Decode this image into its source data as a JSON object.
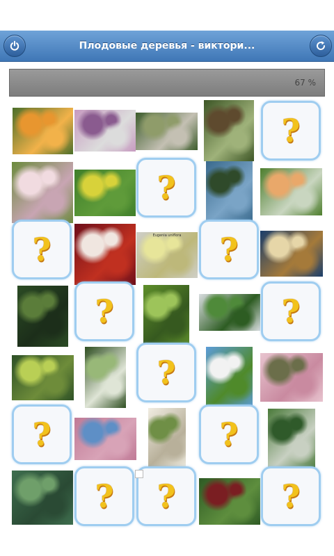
{
  "header": {
    "title": "Плодовые деревья - виктори...",
    "left_button_icon": "power-icon",
    "right_button_icon": "refresh-icon"
  },
  "progress": {
    "value_percent": 67,
    "label": "67 %"
  },
  "card_back": {
    "symbol": "?",
    "color": "#f2c21c"
  },
  "board": {
    "columns": 5,
    "rows": 7,
    "tiles": [
      {
        "state": "revealed",
        "subject": "apricots"
      },
      {
        "state": "revealed",
        "subject": "flowering-tree"
      },
      {
        "state": "revealed",
        "subject": "palm-fronds"
      },
      {
        "state": "revealed",
        "subject": "dark-fruits"
      },
      {
        "state": "hidden"
      },
      {
        "state": "revealed",
        "subject": "quince-blossom"
      },
      {
        "state": "revealed",
        "subject": "yellow-fruit-leaves"
      },
      {
        "state": "hidden"
      },
      {
        "state": "revealed",
        "subject": "tree-canopy"
      },
      {
        "state": "revealed",
        "subject": "round-fruit-leaves"
      },
      {
        "state": "hidden"
      },
      {
        "state": "revealed",
        "subject": "blood-oranges"
      },
      {
        "state": "revealed",
        "subject": "eugenia-fruit"
      },
      {
        "state": "hidden"
      },
      {
        "state": "revealed",
        "subject": "bael-fruit-cut"
      },
      {
        "state": "revealed",
        "subject": "large-tree"
      },
      {
        "state": "hidden"
      },
      {
        "state": "revealed",
        "subject": "leafy-branch"
      },
      {
        "state": "revealed",
        "subject": "green-pod"
      },
      {
        "state": "hidden"
      },
      {
        "state": "revealed",
        "subject": "green-pears"
      },
      {
        "state": "revealed",
        "subject": "leaf-cluster"
      },
      {
        "state": "hidden"
      },
      {
        "state": "revealed",
        "subject": "white-blossom-tree"
      },
      {
        "state": "revealed",
        "subject": "pink-blossom-bird"
      },
      {
        "state": "hidden"
      },
      {
        "state": "revealed",
        "subject": "pink-tree"
      },
      {
        "state": "revealed",
        "subject": "botanical-illustration"
      },
      {
        "state": "hidden"
      },
      {
        "state": "revealed",
        "subject": "hedge-tree"
      },
      {
        "state": "revealed",
        "subject": "green-leaves"
      },
      {
        "state": "hidden"
      },
      {
        "state": "hidden"
      },
      {
        "state": "revealed",
        "subject": "berries-leaves"
      },
      {
        "state": "hidden"
      }
    ]
  },
  "eugenia_caption": "Eugenia uniflora"
}
